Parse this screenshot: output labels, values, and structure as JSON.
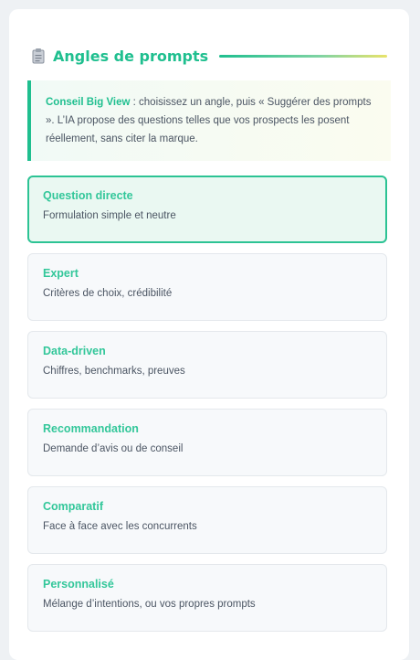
{
  "header": {
    "title": "Angles de prompts",
    "icon": "clipboard-icon"
  },
  "tip": {
    "strong": "Conseil Big View",
    "text": " : choisissez un angle, puis « Suggérer des prompts ». L’IA propose des questions telles que vos prospects les posent réellement, sans citer la marque."
  },
  "angles": [
    {
      "title": "Question directe",
      "description": "Formulation simple et neutre",
      "selected": true
    },
    {
      "title": "Expert",
      "description": "Critères de choix, crédibilité",
      "selected": false
    },
    {
      "title": "Data-driven",
      "description": "Chiffres, benchmarks, preuves",
      "selected": false
    },
    {
      "title": "Recommandation",
      "description": "Demande d’avis ou de conseil",
      "selected": false
    },
    {
      "title": "Comparatif",
      "description": "Face à face avec les concurrents",
      "selected": false
    },
    {
      "title": "Personnalisé",
      "description": "Mélange d’intentions, ou vos propres prompts",
      "selected": false
    }
  ],
  "colors": {
    "accent": "#1fbf8f",
    "selected_bg": "#eaf8f2",
    "card_bg": "#f7f9fb"
  }
}
